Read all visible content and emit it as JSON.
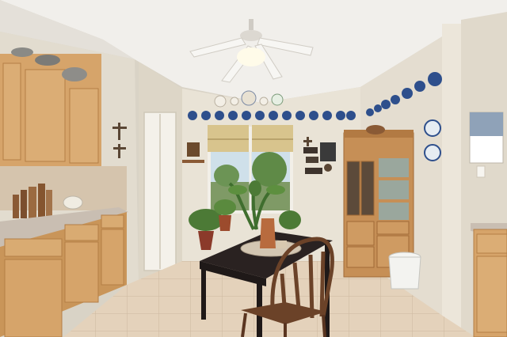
{
  "scene": {
    "palette": {
      "ceiling": "#f1efeb",
      "back_wall": "#e9e3d6",
      "side_wall": "#e2dccf",
      "cabinet": "#d6a46a",
      "cabinet_dark": "#b47e45",
      "countertop": "#c9beb2",
      "floor": "#e4d2bb",
      "table": "#2a2221",
      "chair": "#6b4228",
      "hutch": "#c68f56",
      "plates": "#2e4f8c",
      "curtain": "#d8c48d",
      "plant": "#4c7a36",
      "sky": "#cfe0ea"
    }
  }
}
